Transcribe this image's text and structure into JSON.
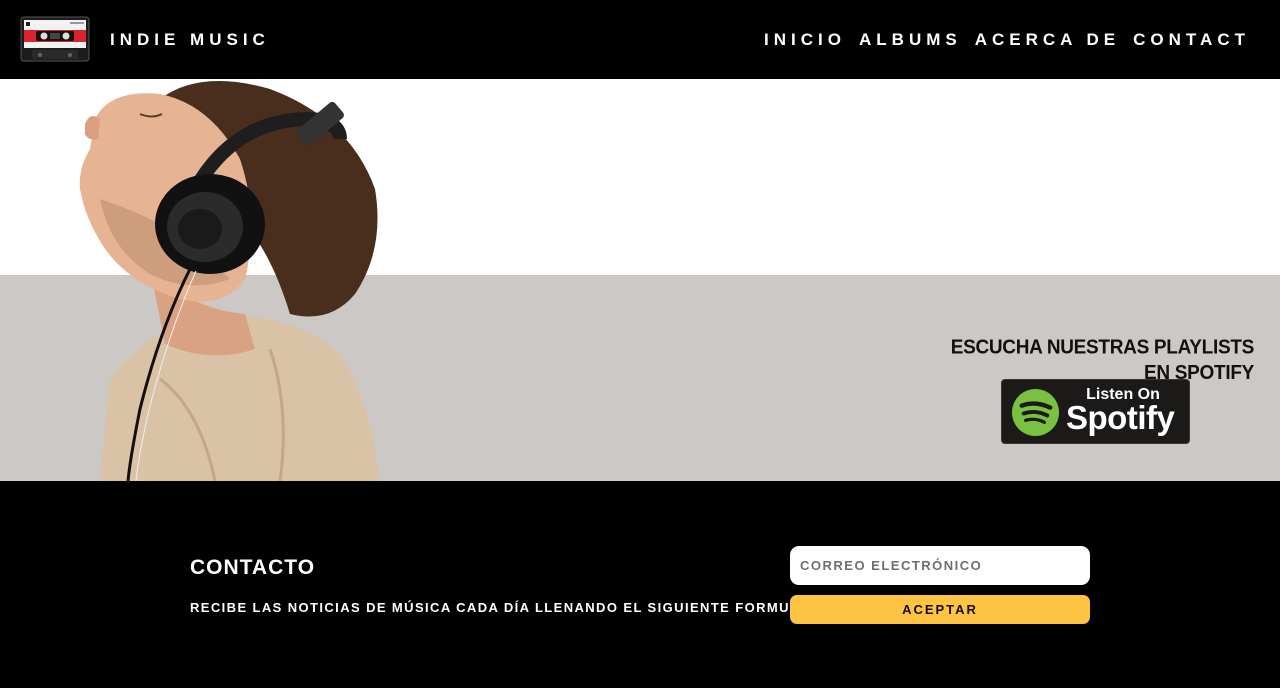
{
  "header": {
    "brand": "INDIE MUSIC",
    "logo_icon": "cassette-tape-icon",
    "nav": [
      {
        "label": "INICIO"
      },
      {
        "label": "ALBUMS"
      },
      {
        "label": "ACERCA DE"
      },
      {
        "label": "CONTACT"
      }
    ]
  },
  "hero": {
    "image": "man-with-headphones-image",
    "promo_title": "ESCUCHA NUESTRAS PLAYLISTS EN SPOTIFY",
    "spotify_badge": {
      "line1": "Listen On",
      "line2": "Spotify",
      "icon": "spotify-logo-icon",
      "color": "#7ac142"
    }
  },
  "contact": {
    "title": "CONTACTO",
    "description": "RECIBE LAS NOTICIAS DE MÚSICA CADA DÍA LLENANDO EL SIGUIENTE FORMULARIO:",
    "email_placeholder": "CORREO ELECTRÓNICO",
    "email_value": "",
    "submit_label": "ACEPTAR"
  },
  "colors": {
    "header_bg": "#000000",
    "band_gray": "#cbc8c5",
    "accent_yellow": "#ffc343",
    "spotify_green": "#7ac142"
  }
}
